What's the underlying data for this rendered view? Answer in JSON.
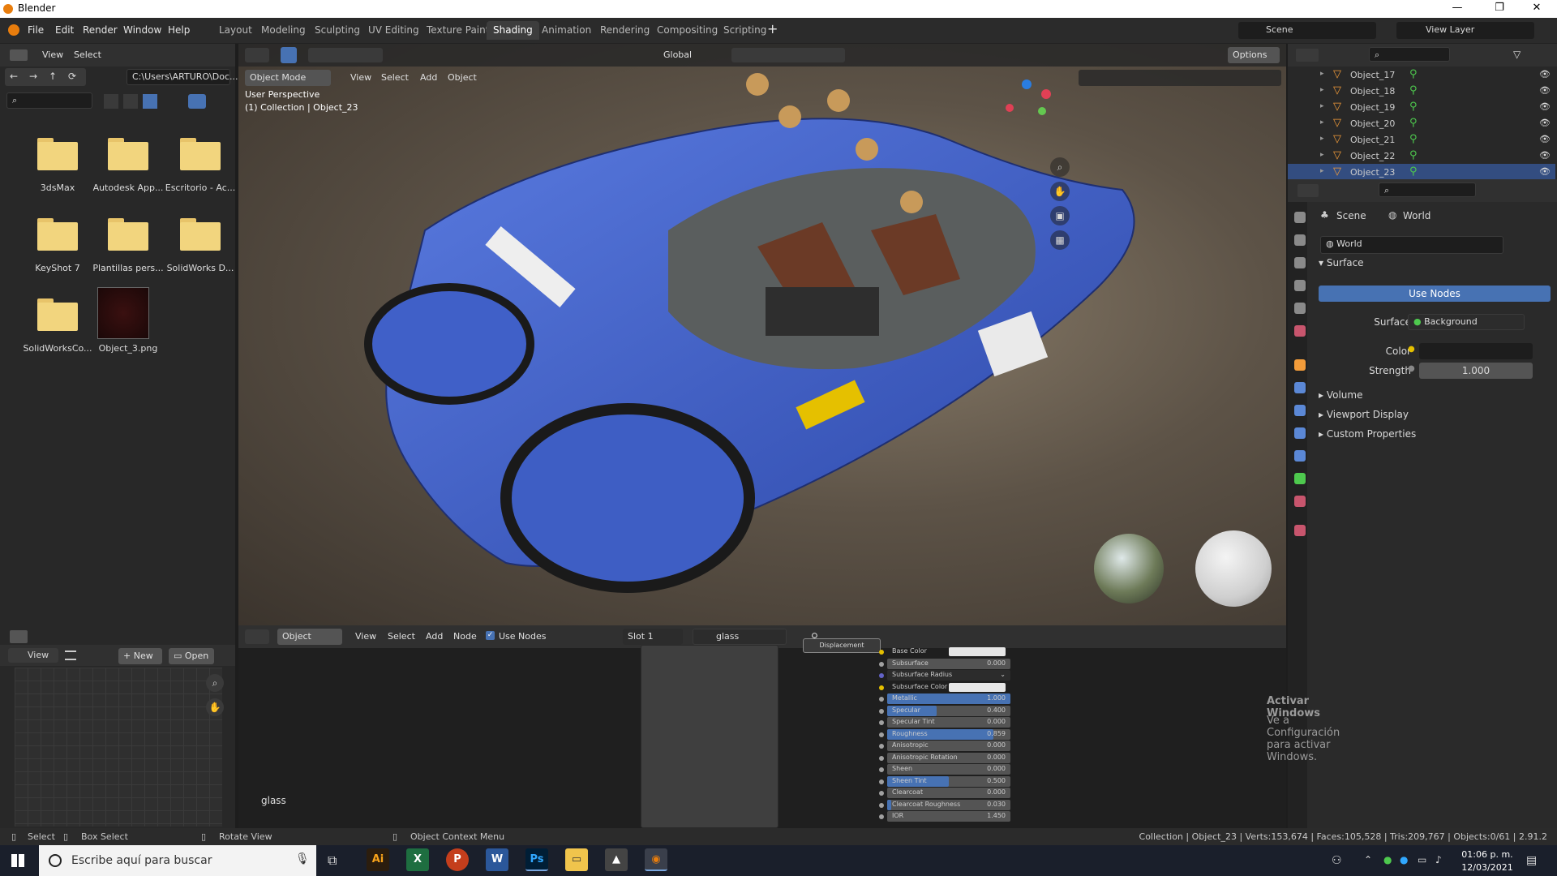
{
  "window": {
    "title": "Blender"
  },
  "menu": {
    "file": "File",
    "edit": "Edit",
    "render": "Render",
    "window": "Window",
    "help": "Help"
  },
  "workspaces": [
    "Layout",
    "Modeling",
    "Sculpting",
    "UV Editing",
    "Texture Paint",
    "Shading",
    "Animation",
    "Rendering",
    "Compositing",
    "Scripting"
  ],
  "active_workspace": "Shading",
  "scene": {
    "name": "Scene",
    "view_layer": "View Layer"
  },
  "file_browser": {
    "view": "View",
    "select": "Select",
    "path": "C:\\Users\\ARTURO\\Doc...",
    "items": [
      "3dsMax",
      "Autodesk App...",
      "Escritorio - Ac...",
      "KeyShot 7",
      "Plantillas pers...",
      "SolidWorks D...",
      "SolidWorksCo...",
      "Object_3.png"
    ]
  },
  "viewport": {
    "mode": "Object Mode",
    "view": "View",
    "select": "Select",
    "add": "Add",
    "object": "Object",
    "orientation": "Global",
    "options": "Options",
    "perspective": "User Perspective",
    "collection": "(1) Collection | Object_23"
  },
  "outliner": {
    "items": [
      "Object_17",
      "Object_18",
      "Object_19",
      "Object_20",
      "Object_21",
      "Object_22",
      "Object_23"
    ]
  },
  "properties": {
    "breadcrumb_scene": "Scene",
    "breadcrumb_world": "World",
    "world_name": "World",
    "surface_panel": "Surface",
    "use_nodes": "Use Nodes",
    "surface_label": "Surface",
    "surface_value": "Background",
    "color_label": "Color",
    "strength_label": "Strength",
    "strength_value": "1.000",
    "volume": "Volume",
    "viewport_display": "Viewport Display",
    "custom_properties": "Custom Properties"
  },
  "image_editor": {
    "view": "View",
    "new": "New",
    "open": "Open"
  },
  "node_editor": {
    "type": "Object",
    "view": "View",
    "select": "Select",
    "add": "Add",
    "node": "Node",
    "use_nodes": "Use Nodes",
    "slot": "Slot 1",
    "material": "glass",
    "label": "glass",
    "displacement": "Displacement",
    "sockets": [
      {
        "label": "Base Color",
        "value": "",
        "kind": "color"
      },
      {
        "label": "Subsurface",
        "value": "0.000",
        "fill": 0
      },
      {
        "label": "Subsurface Radius",
        "value": "",
        "kind": "dropdown"
      },
      {
        "label": "Subsurface Color",
        "value": "",
        "kind": "color"
      },
      {
        "label": "Metallic",
        "value": "1.000",
        "fill": 1
      },
      {
        "label": "Specular",
        "value": "0.400",
        "fill": 0.4
      },
      {
        "label": "Specular Tint",
        "value": "0.000",
        "fill": 0
      },
      {
        "label": "Roughness",
        "value": "0.859",
        "fill": 0.859
      },
      {
        "label": "Anisotropic",
        "value": "0.000",
        "fill": 0
      },
      {
        "label": "Anisotropic Rotation",
        "value": "0.000",
        "fill": 0
      },
      {
        "label": "Sheen",
        "value": "0.000",
        "fill": 0
      },
      {
        "label": "Sheen Tint",
        "value": "0.500",
        "fill": 0.5
      },
      {
        "label": "Clearcoat",
        "value": "0.000",
        "fill": 0
      },
      {
        "label": "Clearcoat Roughness",
        "value": "0.030",
        "fill": 0.03
      },
      {
        "label": "IOR",
        "value": "1.450",
        "fill": 0
      }
    ]
  },
  "watermark": {
    "line1": "Activar Windows",
    "line2": "Ve a Configuración para activar Windows."
  },
  "statusbar": {
    "select": "Select",
    "box_select": "Box Select",
    "rotate_view": "Rotate View",
    "context_menu": "Object Context Menu",
    "stats": "Collection | Object_23 | Verts:153,674 | Faces:105,528 | Tris:209,767 | Objects:0/61 | 2.91.2"
  },
  "taskbar": {
    "search_placeholder": "Escribe aquí para buscar",
    "time": "01:06 p. m.",
    "date": "12/03/2021"
  }
}
